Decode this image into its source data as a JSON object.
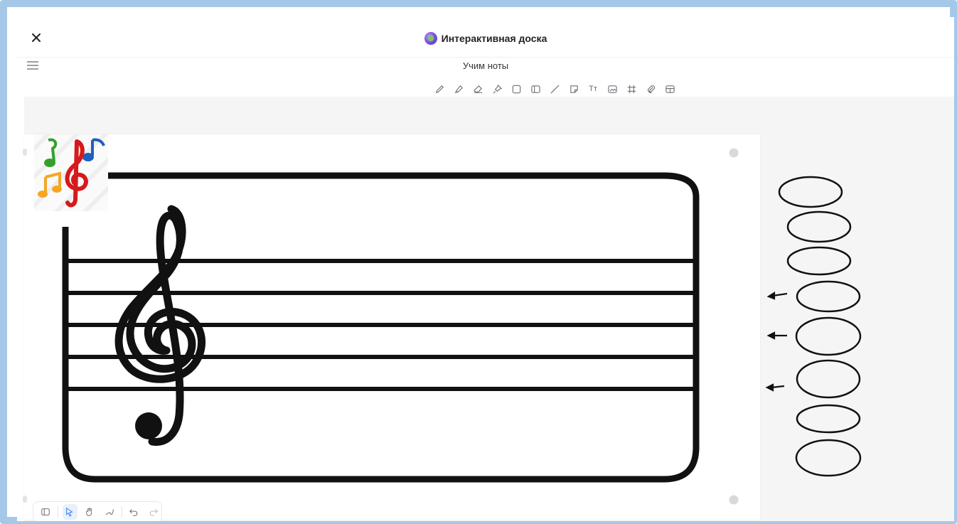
{
  "window": {
    "app_title": "Интерактивная доска",
    "close_icon": "close-icon",
    "logo_icon": "app-logo-icon"
  },
  "board": {
    "name": "Учим ноты",
    "menu_icon": "hamburger-menu-icon"
  },
  "toolbar": {
    "tools": [
      {
        "name": "pencil-icon"
      },
      {
        "name": "marker-icon"
      },
      {
        "name": "eraser-icon"
      },
      {
        "name": "pin-icon"
      },
      {
        "name": "rectangle-icon"
      },
      {
        "name": "frame-icon"
      },
      {
        "name": "line-icon"
      },
      {
        "name": "sticker-icon"
      },
      {
        "name": "text-icon",
        "label": "Tт"
      },
      {
        "name": "image-icon"
      },
      {
        "name": "grid-icon"
      },
      {
        "name": "attachment-icon"
      },
      {
        "name": "table-icon"
      }
    ]
  },
  "bottom_toolbar": {
    "items": [
      {
        "name": "sidebar-toggle-icon"
      },
      {
        "name": "select-cursor-icon",
        "active": true
      },
      {
        "name": "hand-pan-icon"
      },
      {
        "name": "laser-pointer-icon"
      },
      {
        "name": "undo-icon"
      },
      {
        "name": "redo-icon"
      }
    ]
  },
  "canvas": {
    "illustration": "treble-clef-staff",
    "sticker": "music-notes-sticker",
    "note_ovals_count": 8,
    "arrows_count": 3,
    "colors": {
      "frame_border": "#a6c8e8",
      "canvas_bg": "#f5f5f6",
      "ink": "#111111"
    }
  }
}
